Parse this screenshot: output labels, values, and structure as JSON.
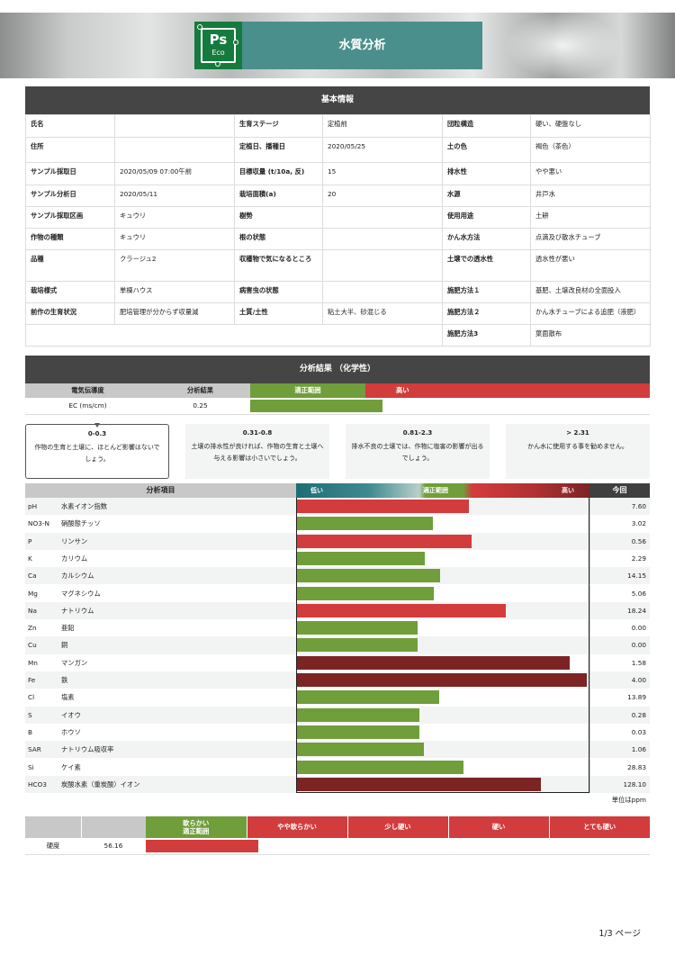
{
  "header": {
    "logo_ps": "Ps",
    "logo_eco": "Eco",
    "title": "水質分析"
  },
  "basic": {
    "title": "基本情報",
    "rows": [
      [
        "氏名",
        "",
        "生育ステージ",
        "定植前",
        "団粒構造",
        "硬い、硬盤なし"
      ],
      [
        "住所",
        "",
        "定植日、播種日",
        "2020/05/25",
        "土の色",
        "褐色（茶色）"
      ],
      [
        "サンプル採取日",
        "2020/05/09 07:00午前",
        "目標収量 (t/10a, 反)",
        "15",
        "排水性",
        "やや悪い"
      ],
      [
        "サンプル分析日",
        "2020/05/11",
        "栽培面積(a)",
        "20",
        "水源",
        "井戸水"
      ],
      [
        "サンプル採取区画",
        "キュウリ",
        "樹勢",
        "",
        "使用用途",
        "土耕"
      ],
      [
        "作物の種類",
        "キュウリ",
        "根の状態",
        "",
        "かん水方法",
        "点滴及び散水チューブ"
      ],
      [
        "品種",
        "クラージュ2",
        "収穫物で気になるところ",
        "",
        "土壌での透水性",
        "透水性が悪い"
      ],
      [
        "栽培様式",
        "単棟ハウス",
        "病害虫の状態",
        "",
        "施肥方法１",
        "基肥、土壌改良材の全面投入"
      ],
      [
        "前作の生育状況",
        "肥培管理が分からず収量減",
        "土質/土性",
        "粘土大半、砂混じる",
        "施肥方法２",
        "かん水チューブによる追肥（液肥）"
      ],
      [
        "",
        "",
        "",
        "",
        "施肥方法3",
        "葉面散布"
      ]
    ]
  },
  "analysis": {
    "title": "分析結果 （化学性）",
    "ec": {
      "headers": [
        "電気伝導度",
        "分析結果",
        "適正範囲",
        "高い"
      ],
      "label": "EC (ms/cm)",
      "value": "0.25",
      "bar_fraction": 0.33
    },
    "ranges": [
      {
        "range": "0-0.3",
        "desc": "作物の生育と土壌に、ほとんど影響はないでしょう。"
      },
      {
        "range": "0.31-0.8",
        "desc": "土壌の排水性が良ければ、作物の生育と土壌へ与える影響は小さいでしょう。"
      },
      {
        "range": "0.81-2.3",
        "desc": "排水不良の土壌では、作物に塩害の影響が出るでしょう。"
      },
      {
        "range": "> 2.31",
        "desc": "かん水に使用する事を勧めません。"
      }
    ],
    "table_headers": {
      "item": "分析項目",
      "low": "低い",
      "ok": "適正範囲",
      "high": "高い",
      "current": "今回"
    },
    "items": [
      {
        "sym": "pH",
        "name": "水素イオン指数",
        "value": "7.60",
        "level": 0.59,
        "color": "#d23c3c"
      },
      {
        "sym": "NO3-N",
        "name": "硝酸態チッソ",
        "value": "3.02",
        "level": 0.465,
        "color": "#6f9e3a"
      },
      {
        "sym": "P",
        "name": "リンサン",
        "value": "0.56",
        "level": 0.597,
        "color": "#d23c3c"
      },
      {
        "sym": "K",
        "name": "カリウム",
        "value": "2.29",
        "level": 0.438,
        "color": "#6f9e3a"
      },
      {
        "sym": "Ca",
        "name": "カルシウム",
        "value": "14.15",
        "level": 0.49,
        "color": "#6f9e3a"
      },
      {
        "sym": "Mg",
        "name": "マグネシウム",
        "value": "5.06",
        "level": 0.468,
        "color": "#6f9e3a"
      },
      {
        "sym": "Na",
        "name": "ナトリウム",
        "value": "18.24",
        "level": 0.715,
        "color": "#d23c3c"
      },
      {
        "sym": "Zn",
        "name": "亜鉛",
        "value": "0.00",
        "level": 0.415,
        "color": "#6f9e3a"
      },
      {
        "sym": "Cu",
        "name": "銅",
        "value": "0.00",
        "level": 0.415,
        "color": "#6f9e3a"
      },
      {
        "sym": "Mn",
        "name": "マンガン",
        "value": "1.58",
        "level": 0.933,
        "color": "#7c2424"
      },
      {
        "sym": "Fe",
        "name": "鉄",
        "value": "4.00",
        "level": 0.99,
        "color": "#7c2424"
      },
      {
        "sym": "Cl",
        "name": "塩素",
        "value": "13.89",
        "level": 0.488,
        "color": "#6f9e3a"
      },
      {
        "sym": "S",
        "name": "イオウ",
        "value": "0.28",
        "level": 0.42,
        "color": "#6f9e3a"
      },
      {
        "sym": "B",
        "name": "ホウソ",
        "value": "0.03",
        "level": 0.42,
        "color": "#6f9e3a"
      },
      {
        "sym": "SAR",
        "name": "ナトリウム吸収率",
        "value": "1.06",
        "level": 0.435,
        "color": "#6f9e3a"
      },
      {
        "sym": "Si",
        "name": "ケイ素",
        "value": "28.83",
        "level": 0.57,
        "color": "#6f9e3a"
      },
      {
        "sym": "HCO3",
        "name": "炭酸水素（重炭酸）イオン",
        "value": "128.10",
        "level": 0.835,
        "color": "#7c2424"
      }
    ],
    "unit": "単位はppm"
  },
  "hardness": {
    "headers": [
      "軟らかい\n適正範囲",
      "やや軟らかい",
      "少し硬い",
      "硬い",
      "とても硬い"
    ],
    "label": "硬度",
    "value": "56.16",
    "bar_fraction": 0.18
  },
  "footer": {
    "page": "1/3 ページ"
  }
}
